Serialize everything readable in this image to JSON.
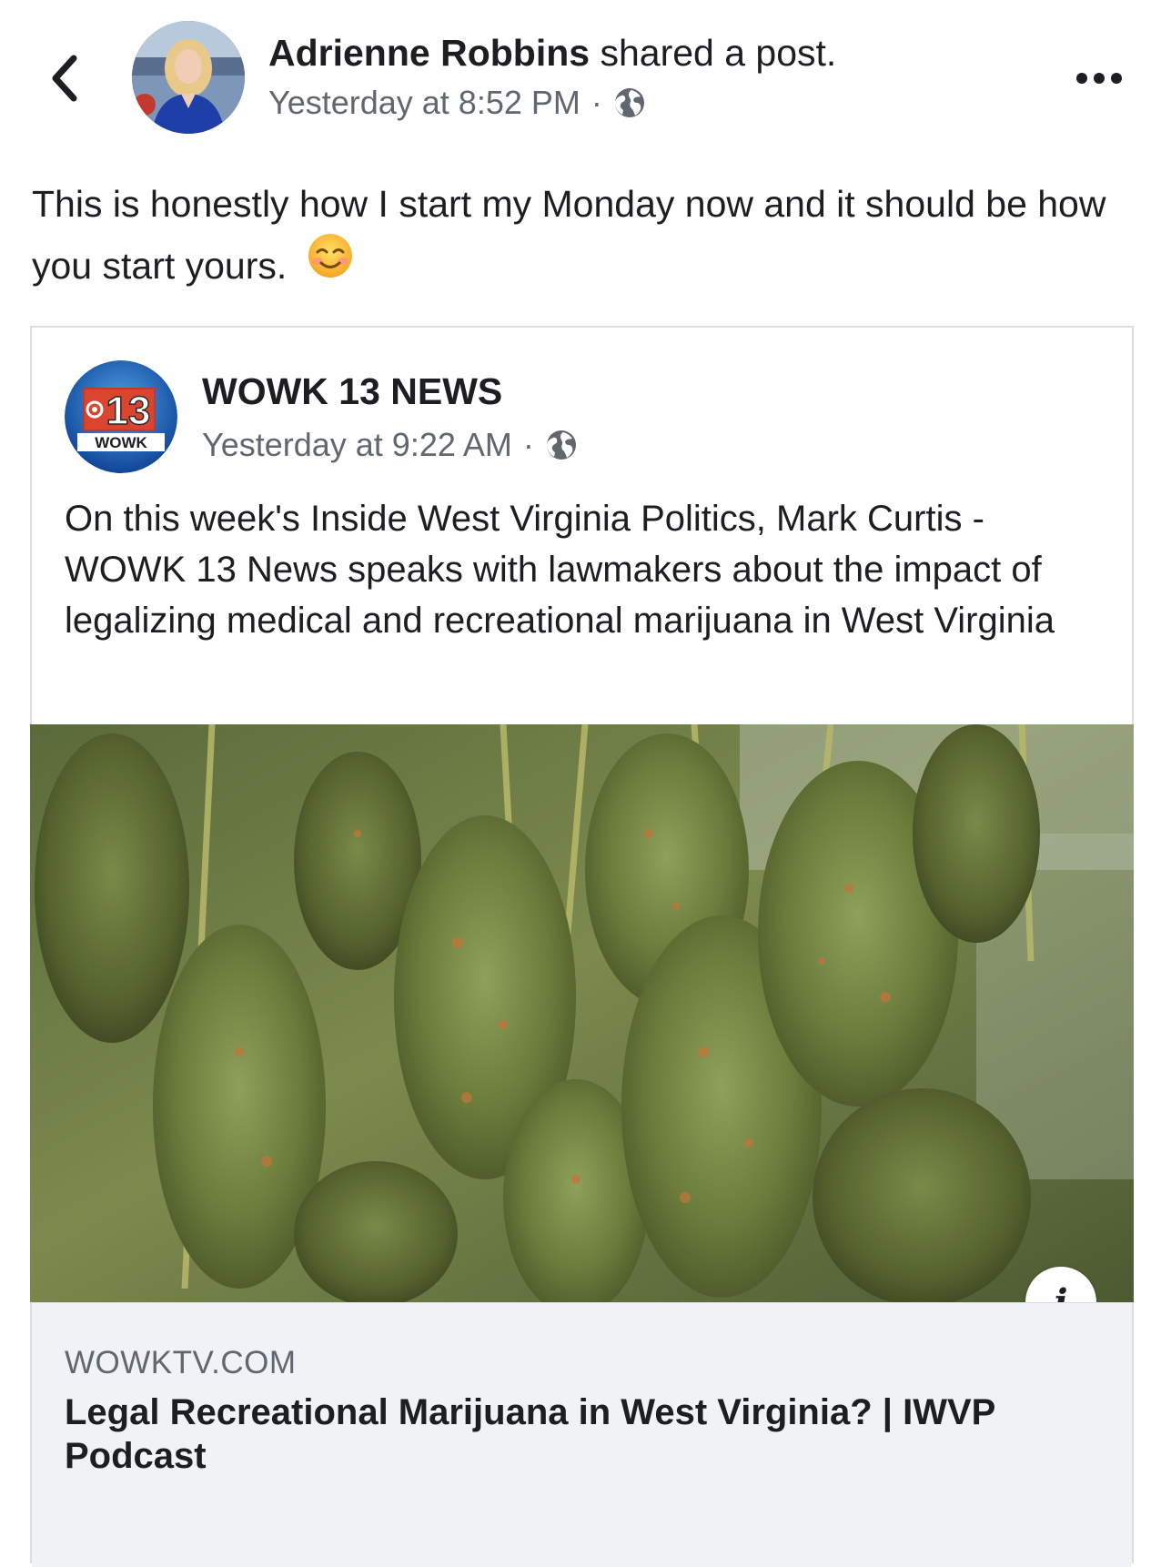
{
  "header": {
    "author_name": "Adrienne Robbins",
    "action": "shared a post.",
    "timestamp": "Yesterday at 8:52 PM",
    "separator": "·",
    "privacy_icon": "globe-icon",
    "back_icon": "chevron-left-icon",
    "more_icon": "ellipsis-icon"
  },
  "post": {
    "text": "This is honestly how I start my Monday now and it should be how you start yours.",
    "emoji": "smiling-face-icon"
  },
  "shared": {
    "page_name": "WOWK 13 NEWS",
    "timestamp": "Yesterday at 9:22 AM",
    "separator": "·",
    "logo_number": "13",
    "logo_text": "WOWK",
    "text": "On this week's Inside West Virginia Politics, Mark Curtis - WOWK 13 News speaks with lawmakers about the impact of legalizing medical and recreational marijuana in West Virginia",
    "info_label": "i",
    "link": {
      "domain": "WOWKTV.COM",
      "title": "Legal Recreational Marijuana in West Virginia? | IWVP Podcast"
    }
  },
  "colors": {
    "primary_text": "#1c1e21",
    "secondary_text": "#606770",
    "card_border": "#dadde1",
    "link_footer_bg": "#f0f2f5"
  }
}
